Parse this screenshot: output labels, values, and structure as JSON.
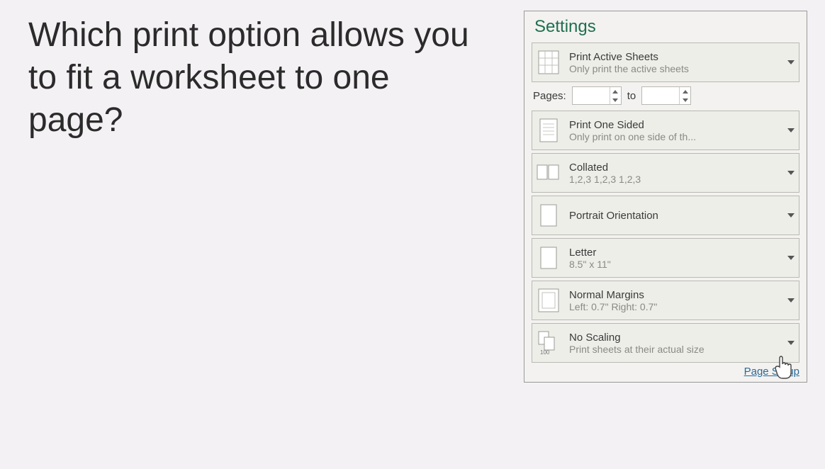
{
  "question": "Which print option allows you to fit a worksheet to one page?",
  "panel": {
    "title": "Settings",
    "options": {
      "printWhat": {
        "label": "Print Active Sheets",
        "sub": "Only print the active sheets"
      },
      "pages": {
        "label": "Pages:",
        "to": "to"
      },
      "sides": {
        "label": "Print One Sided",
        "sub": "Only print on one side of th..."
      },
      "collate": {
        "label": "Collated",
        "sub": "1,2,3   1,2,3   1,2,3"
      },
      "orient": {
        "label": "Portrait Orientation",
        "sub": ""
      },
      "size": {
        "label": "Letter",
        "sub": "8.5\" x 11\""
      },
      "margins": {
        "label": "Normal Margins",
        "sub": "Left:  0.7\"    Right:  0.7\""
      },
      "scaling": {
        "label": "No Scaling",
        "sub": "Print sheets at their actual size"
      }
    },
    "pageSetup": "Page Setup"
  }
}
